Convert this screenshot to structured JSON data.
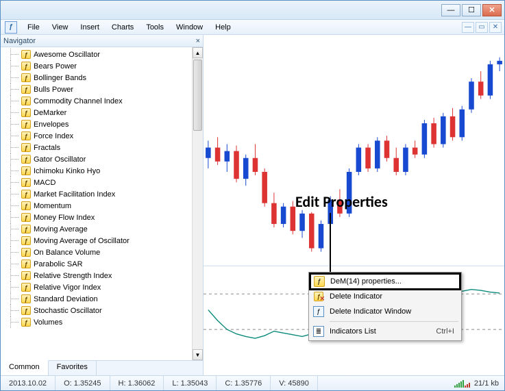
{
  "titlebar": {
    "min": "—",
    "max": "☐",
    "close": "✕"
  },
  "menu": {
    "items": [
      "File",
      "View",
      "Insert",
      "Charts",
      "Tools",
      "Window",
      "Help"
    ],
    "app_icon": "ƒ"
  },
  "mdi": {
    "min": "—",
    "restore": "▭",
    "close": "✕"
  },
  "navigator": {
    "title": "Navigator",
    "close": "×",
    "items": [
      "Awesome Oscillator",
      "Bears Power",
      "Bollinger Bands",
      "Bulls Power",
      "Commodity Channel Index",
      "DeMarker",
      "Envelopes",
      "Force Index",
      "Fractals",
      "Gator Oscillator",
      "Ichimoku Kinko Hyo",
      "MACD",
      "Market Facilitation Index",
      "Momentum",
      "Money Flow Index",
      "Moving Average",
      "Moving Average of Oscillator",
      "On Balance Volume",
      "Parabolic SAR",
      "Relative Strength Index",
      "Relative Vigor Index",
      "Standard Deviation",
      "Stochastic Oscillator",
      "Volumes"
    ],
    "tabs": {
      "common": "Common",
      "favorites": "Favorites"
    }
  },
  "annotation": {
    "label": "Edit Properties"
  },
  "context_menu": {
    "properties": "DeM(14) properties...",
    "delete_ind": "Delete Indicator",
    "delete_win": "Delete Indicator Window",
    "ind_list": "Indicators List",
    "ind_list_sc": "Ctrl+I"
  },
  "status": {
    "date": "2013.10.02",
    "o_label": "O:",
    "o": "1.35245",
    "h_label": "H:",
    "h": "1.36062",
    "l_label": "L:",
    "l": "1.35043",
    "c_label": "C:",
    "c": "1.35776",
    "v_label": "V:",
    "v": "45890",
    "conn": "21/1 kb"
  },
  "chart_data": {
    "type": "candlestick",
    "title": "",
    "xlabel": "",
    "ylabel": "",
    "candles": [
      {
        "o": 1.354,
        "h": 1.3565,
        "l": 1.3525,
        "c": 1.3555,
        "color": "blue"
      },
      {
        "o": 1.3555,
        "h": 1.357,
        "l": 1.353,
        "c": 1.3535,
        "color": "red"
      },
      {
        "o": 1.3535,
        "h": 1.356,
        "l": 1.352,
        "c": 1.355,
        "color": "blue"
      },
      {
        "o": 1.355,
        "h": 1.3558,
        "l": 1.3505,
        "c": 1.351,
        "color": "red"
      },
      {
        "o": 1.351,
        "h": 1.3545,
        "l": 1.35,
        "c": 1.354,
        "color": "blue"
      },
      {
        "o": 1.354,
        "h": 1.356,
        "l": 1.3515,
        "c": 1.352,
        "color": "red"
      },
      {
        "o": 1.352,
        "h": 1.3525,
        "l": 1.347,
        "c": 1.3475,
        "color": "red"
      },
      {
        "o": 1.3475,
        "h": 1.349,
        "l": 1.344,
        "c": 1.3445,
        "color": "red"
      },
      {
        "o": 1.3445,
        "h": 1.3475,
        "l": 1.344,
        "c": 1.347,
        "color": "blue"
      },
      {
        "o": 1.347,
        "h": 1.3478,
        "l": 1.343,
        "c": 1.3435,
        "color": "red"
      },
      {
        "o": 1.3435,
        "h": 1.3465,
        "l": 1.3425,
        "c": 1.346,
        "color": "blue"
      },
      {
        "o": 1.346,
        "h": 1.3462,
        "l": 1.3405,
        "c": 1.341,
        "color": "red"
      },
      {
        "o": 1.341,
        "h": 1.345,
        "l": 1.3405,
        "c": 1.3445,
        "color": "blue"
      },
      {
        "o": 1.3445,
        "h": 1.3485,
        "l": 1.344,
        "c": 1.348,
        "color": "blue"
      },
      {
        "o": 1.348,
        "h": 1.3495,
        "l": 1.3455,
        "c": 1.346,
        "color": "red"
      },
      {
        "o": 1.346,
        "h": 1.3525,
        "l": 1.3455,
        "c": 1.352,
        "color": "blue"
      },
      {
        "o": 1.352,
        "h": 1.356,
        "l": 1.3515,
        "c": 1.3555,
        "color": "blue"
      },
      {
        "o": 1.3555,
        "h": 1.356,
        "l": 1.352,
        "c": 1.3525,
        "color": "red"
      },
      {
        "o": 1.3525,
        "h": 1.357,
        "l": 1.352,
        "c": 1.3565,
        "color": "blue"
      },
      {
        "o": 1.3565,
        "h": 1.3572,
        "l": 1.3535,
        "c": 1.354,
        "color": "red"
      },
      {
        "o": 1.354,
        "h": 1.3555,
        "l": 1.3515,
        "c": 1.352,
        "color": "red"
      },
      {
        "o": 1.352,
        "h": 1.356,
        "l": 1.3515,
        "c": 1.3555,
        "color": "blue"
      },
      {
        "o": 1.3555,
        "h": 1.3565,
        "l": 1.354,
        "c": 1.3545,
        "color": "red"
      },
      {
        "o": 1.3545,
        "h": 1.3595,
        "l": 1.354,
        "c": 1.359,
        "color": "blue"
      },
      {
        "o": 1.359,
        "h": 1.3598,
        "l": 1.3555,
        "c": 1.356,
        "color": "red"
      },
      {
        "o": 1.356,
        "h": 1.3605,
        "l": 1.3555,
        "c": 1.36,
        "color": "blue"
      },
      {
        "o": 1.36,
        "h": 1.3612,
        "l": 1.3565,
        "c": 1.357,
        "color": "red"
      },
      {
        "o": 1.357,
        "h": 1.3615,
        "l": 1.3565,
        "c": 1.361,
        "color": "blue"
      },
      {
        "o": 1.361,
        "h": 1.3655,
        "l": 1.3605,
        "c": 1.365,
        "color": "blue"
      },
      {
        "o": 1.365,
        "h": 1.3665,
        "l": 1.3625,
        "c": 1.363,
        "color": "red"
      },
      {
        "o": 1.363,
        "h": 1.368,
        "l": 1.3625,
        "c": 1.3675,
        "color": "blue"
      },
      {
        "o": 1.3675,
        "h": 1.3685,
        "l": 1.3665,
        "c": 1.368,
        "color": "blue"
      }
    ],
    "indicator": {
      "name": "DeM(14)",
      "upper": 0.7,
      "lower": 0.3,
      "values": [
        0.52,
        0.4,
        0.3,
        0.25,
        0.22,
        0.2,
        0.23,
        0.28,
        0.26,
        0.24,
        0.22,
        0.25,
        0.32,
        0.45,
        0.58,
        0.62,
        0.55,
        0.6,
        0.66,
        0.7,
        0.74,
        0.72,
        0.68,
        0.65,
        0.63,
        0.66,
        0.7,
        0.73,
        0.75,
        0.74,
        0.72,
        0.71
      ]
    }
  }
}
